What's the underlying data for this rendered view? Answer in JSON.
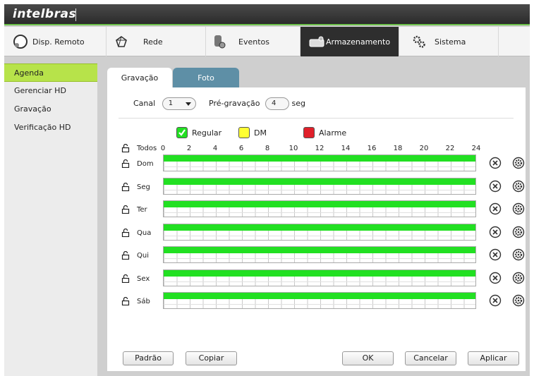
{
  "brand": {
    "logo": "intelbras"
  },
  "nav": [
    {
      "label": "Disp. Remoto",
      "icon": "remote-device-icon"
    },
    {
      "label": "Rede",
      "icon": "network-icon"
    },
    {
      "label": "Eventos",
      "icon": "events-icon"
    },
    {
      "label": "Armazenamento",
      "icon": "storage-icon",
      "active": true
    },
    {
      "label": "Sistema",
      "icon": "gear-icon"
    }
  ],
  "sidebar": {
    "items": [
      {
        "label": "Agenda",
        "active": true
      },
      {
        "label": "Gerenciar HD"
      },
      {
        "label": "Gravação"
      },
      {
        "label": "Verificação HD"
      }
    ]
  },
  "tabs": {
    "recording": "Gravação",
    "photo": "Foto"
  },
  "channel": {
    "label": "Canal",
    "value": "1"
  },
  "prerecord": {
    "label": "Pré-gravação",
    "value": "4",
    "unit": "seg"
  },
  "legend": {
    "regular": {
      "label": "Regular",
      "color": "#22e022",
      "checked": true
    },
    "dm": {
      "label": "DM",
      "color": "#ffff33"
    },
    "alarm": {
      "label": "Alarme",
      "color": "#e0202a"
    }
  },
  "schedule": {
    "all_label": "Todos",
    "hours": [
      "0",
      "2",
      "4",
      "6",
      "8",
      "10",
      "12",
      "14",
      "16",
      "18",
      "20",
      "22",
      "24"
    ],
    "days": [
      "Dom",
      "Seg",
      "Ter",
      "Qua",
      "Qui",
      "Sex",
      "Sáb"
    ],
    "fill_fraction": 1.0
  },
  "buttons": {
    "default": "Padrão",
    "copy": "Copiar",
    "ok": "OK",
    "cancel": "Cancelar",
    "apply": "Aplicar"
  }
}
